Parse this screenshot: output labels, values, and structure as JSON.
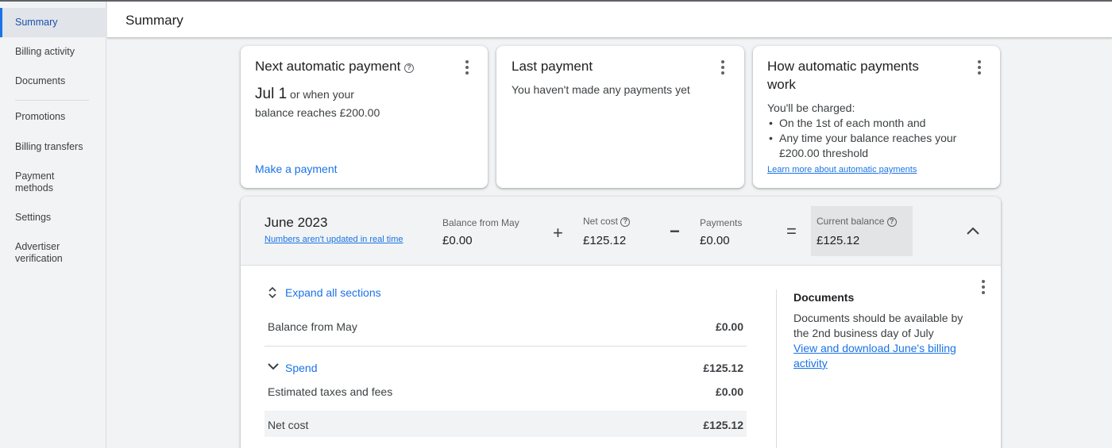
{
  "sidebar": {
    "items": [
      {
        "label": "Summary"
      },
      {
        "label": "Billing activity"
      },
      {
        "label": "Documents"
      },
      {
        "label": "Promotions"
      },
      {
        "label": "Billing transfers"
      },
      {
        "label": "Payment methods"
      },
      {
        "label": "Settings"
      },
      {
        "label": "Advertiser verification"
      }
    ]
  },
  "header": {
    "title": "Summary"
  },
  "cards": {
    "next_payment": {
      "title": "Next automatic payment",
      "date": "Jul 1",
      "date_suffix": "or when your",
      "line2": "balance reaches £200.00",
      "action": "Make a payment"
    },
    "last_payment": {
      "title": "Last payment",
      "text": "You haven't made any payments yet"
    },
    "how_it_works": {
      "title_line1": "How automatic payments",
      "title_line2": "work",
      "intro": "You'll be charged:",
      "bullet1": "On the 1st of each month and",
      "bullet2_line1": "Any time your balance reaches your",
      "bullet2_line2": "£200.00 threshold",
      "link": "Learn more about automatic payments"
    }
  },
  "balance": {
    "month": "June 2023",
    "realtime_note": "Numbers aren't updated in real time",
    "from_label": "Balance from May",
    "from_value": "£0.00",
    "plus": "+",
    "net_label": "Net cost",
    "net_value": "£125.12",
    "minus": "−",
    "payments_label": "Payments",
    "payments_value": "£0.00",
    "equals": "=",
    "current_label": "Current balance",
    "current_value": "£125.12"
  },
  "details": {
    "expand_all": "Expand all sections",
    "rows": [
      {
        "label": "Balance from May",
        "value": "£0.00"
      },
      {
        "label": "Spend",
        "value": "£125.12"
      },
      {
        "label": "Estimated taxes and fees",
        "value": "£0.00"
      },
      {
        "label": "Net cost",
        "value": "£125.12"
      }
    ]
  },
  "documents": {
    "title": "Documents",
    "line1": "Documents should be available by",
    "line2": "the 2nd business day of July",
    "link_line1": "View and download June's billing",
    "link_line2": "activity"
  },
  "colors": {
    "accent": "#1a73e8",
    "active_bg": "#e1e4e8",
    "page_bg": "#f1f3f4"
  }
}
